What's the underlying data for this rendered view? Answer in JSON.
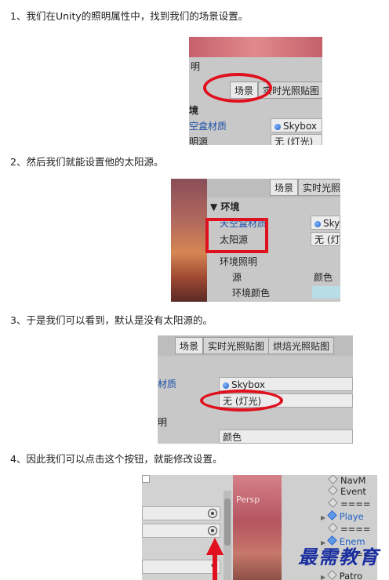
{
  "steps": [
    "1、我们在Unity的照明属性中，找到我们的场景设置。",
    "2、然后我们就能设置他的太阳源。",
    "3、于是我们可以看到，默认是没有太阳源的。",
    "4、因此我们可以点击这个按钮，就能修改设置。"
  ],
  "shot1": {
    "window_title_fragment": "明",
    "tab_scene": "场景",
    "tab_realtime": "实时光照贴图",
    "section": "境",
    "row_label": "空盒材质",
    "row_value": "Skybox",
    "row2_label": "明源",
    "row2_value": "无 (灯光)"
  },
  "shot2": {
    "tab_scene": "场景",
    "tab_realtime": "实时光照",
    "section": "环境",
    "row1_label": "天空盒材质",
    "row1_value": "Sky",
    "row2_label": "太阳源",
    "row2_value": "无 (灯光",
    "row3_label": "环境照明",
    "row4_label": "源",
    "row4_value": "颜色",
    "row5_label": "环境颜色"
  },
  "shot3": {
    "tab_scene": "场景",
    "tab_realtime": "实时光照贴图",
    "tab_baked": "烘焙光照贴图",
    "row1_label": "材质",
    "row1_value": "Skybox",
    "row2_value": "无 (灯光)",
    "row3_label": "明",
    "row4_value": "颜色"
  },
  "shot4": {
    "persp_label": "Persp",
    "hierarchy": [
      "NavM",
      "Event",
      "====",
      "Playe",
      "====",
      "Enem",
      "====",
      "Patro"
    ]
  },
  "watermark": "最需教育",
  "colors": {
    "highlight_red": "#e0101e",
    "inspector_gray": "#c8c8c8",
    "link_blue": "#1d4fa8"
  }
}
